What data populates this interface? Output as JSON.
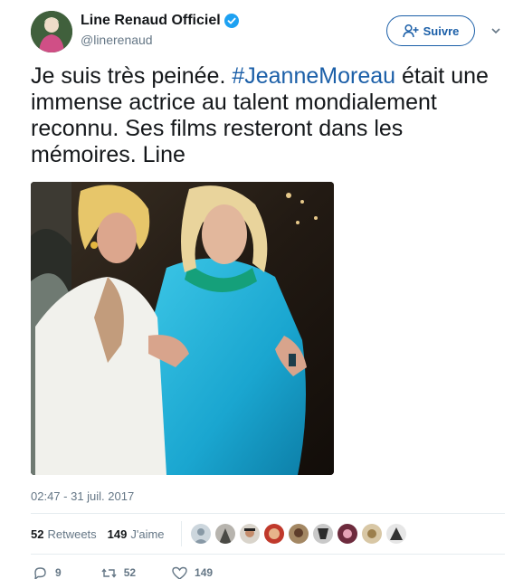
{
  "tweet": {
    "author": {
      "display_name": "Line Renaud Officiel",
      "handle": "@linerenaud",
      "verified_icon": "verified-badge-icon"
    },
    "follow_button": {
      "label": "Suivre",
      "icon": "add-user-icon"
    },
    "menu_icon": "chevron-down-icon",
    "text_before": "Je suis très peinée. ",
    "hashtag": "#JeanneMoreau",
    "text_after": " était une immense actrice au talent mondialement reconnu. Ses films resteront dans les mémoires. Line",
    "timestamp": "02:47 - 31 juil. 2017",
    "stats": {
      "retweets_count": "52",
      "retweets_label": "Retweets",
      "likes_count": "149",
      "likes_label": "J'aime"
    },
    "likers_count": 9,
    "actions": {
      "reply_count": "9",
      "retweet_count": "52",
      "like_count": "149"
    }
  },
  "colors": {
    "link": "#1b5fa8",
    "secondary_text": "#657786",
    "divider": "#e6ecf0",
    "verified": "#1da1f2"
  }
}
